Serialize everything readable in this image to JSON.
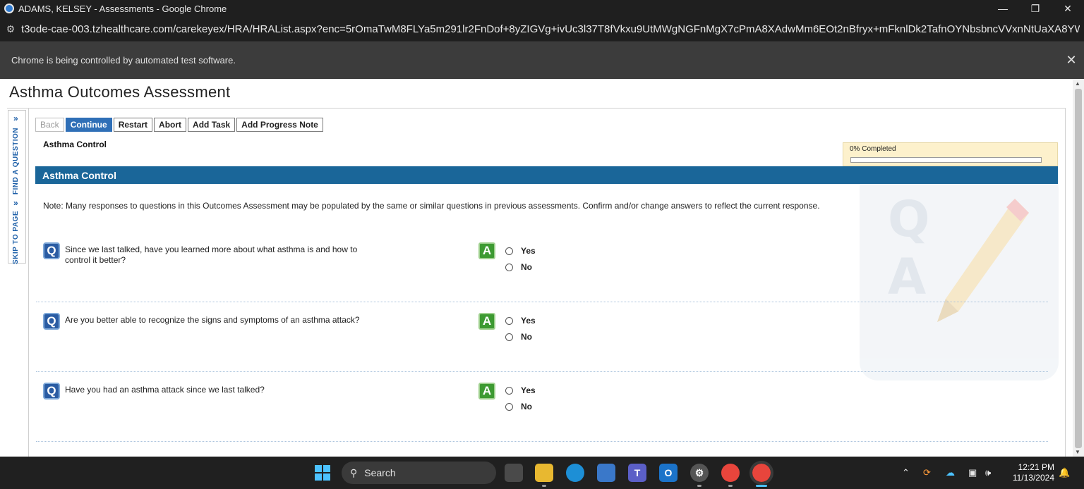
{
  "window": {
    "title": "ADAMS, KELSEY - Assessments - Google Chrome",
    "url": "t3ode-cae-003.tzhealthcare.com/carekeyex/HRA/HRAList.aspx?enc=5rOmaTwM8FLYa5m291lr2FnDof+8yZIGVg+ivUc3l37T8fVkxu9UtMWgNGFnMgX7cPmA8XAdwMm6EOt2nBfryx+mFknlDk2TafnOYNbsbncVVxnNtUaXA8YWpbOPslzf0cx7Lo..."
  },
  "infobar": {
    "message": "Chrome is being controlled by automated test software."
  },
  "page": {
    "title": "Asthma Outcomes Assessment",
    "sidetabs": {
      "find": "FIND A QUESTION",
      "skip": "SKIP TO PAGE"
    },
    "toolbar": {
      "back": "Back",
      "continue": "Continue",
      "restart": "Restart",
      "abort": "Abort",
      "add_task": "Add Task",
      "add_note": "Add Progress Note"
    },
    "section_label": "Asthma Control",
    "progress": {
      "text": "0% Completed",
      "value": 0
    },
    "section_header": "Asthma Control",
    "note": "Note: Many responses to questions in this Outcomes Assessment may be populated by the same or similar questions in previous assessments. Confirm and/or change answers to reflect the current response.",
    "questions": [
      {
        "text": "Since we last talked, have you learned more about what asthma is and how to control it better?",
        "options": [
          "Yes",
          "No"
        ]
      },
      {
        "text": "Are you better able to recognize the signs and symptoms of an asthma attack?",
        "options": [
          "Yes",
          "No"
        ]
      },
      {
        "text": "Have you had an asthma attack since we last talked?",
        "options": [
          "Yes",
          "No"
        ]
      }
    ],
    "q_icon": "Q",
    "a_icon": "A",
    "watermark": {
      "q": "Q",
      "a": "A"
    }
  },
  "taskbar": {
    "search_label": "Search",
    "time": "12:21 PM",
    "date": "11/13/2024",
    "teams_label": "T",
    "outlook_label": "O"
  },
  "colors": {
    "accent": "#1a6699",
    "button_primary": "#2f6fb7",
    "progress_bg": "#fdf1cc"
  }
}
